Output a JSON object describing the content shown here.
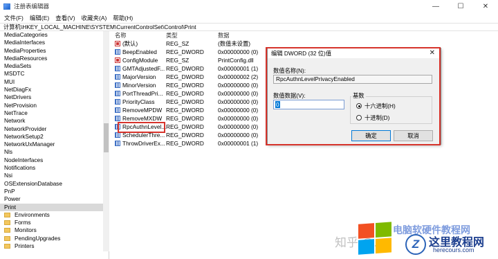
{
  "window": {
    "title": "注册表编辑器",
    "minimize": "—",
    "maximize": "☐",
    "close": "✕"
  },
  "menu": [
    "文件(F)",
    "编辑(E)",
    "查看(V)",
    "收藏夹(A)",
    "帮助(H)"
  ],
  "address": "计算机\\HKEY_LOCAL_MACHINE\\SYSTEM\\CurrentControlSet\\Control\\Print",
  "tree": {
    "items": [
      "MediaCategories",
      "MediaInterfaces",
      "MediaProperties",
      "MediaResources",
      "MediaSets",
      "MSDTC",
      "MUI",
      "NetDiagFx",
      "NetDrivers",
      "NetProvision",
      "NetTrace",
      "Network",
      "NetworkProvider",
      "NetworkSetup2",
      "NetworkUxManager",
      "Nls",
      "NodeInterfaces",
      "Notifications",
      "Nsi",
      "OSExtensionDatabase",
      "PnP",
      "Power",
      "Print"
    ],
    "children": [
      "Environments",
      "Forms",
      "Monitors",
      "PendingUpgrades",
      "Printers"
    ],
    "selected": "Print"
  },
  "list": {
    "headers": {
      "name": "名称",
      "type": "类型",
      "data": "数据"
    },
    "rows": [
      {
        "name": "(默认)",
        "type": "REG_SZ",
        "data": "(数值未设置)",
        "kind": "sz"
      },
      {
        "name": "BeepEnabled",
        "type": "REG_DWORD",
        "data": "0x00000000 (0)",
        "kind": "dw"
      },
      {
        "name": "ConfigModule",
        "type": "REG_SZ",
        "data": "PrintConfig.dll",
        "kind": "sz"
      },
      {
        "name": "GMTAdjustedF...",
        "type": "REG_DWORD",
        "data": "0x00000001 (1)",
        "kind": "dw"
      },
      {
        "name": "MajorVersion",
        "type": "REG_DWORD",
        "data": "0x00000002 (2)",
        "kind": "dw"
      },
      {
        "name": "MinorVersion",
        "type": "REG_DWORD",
        "data": "0x00000000 (0)",
        "kind": "dw"
      },
      {
        "name": "PortThreadPri...",
        "type": "REG_DWORD",
        "data": "0x00000000 (0)",
        "kind": "dw"
      },
      {
        "name": "PriorityClass",
        "type": "REG_DWORD",
        "data": "0x00000000 (0)",
        "kind": "dw"
      },
      {
        "name": "RemoveMPDW",
        "type": "REG_DWORD",
        "data": "0x00000000 (0)",
        "kind": "dw"
      },
      {
        "name": "RemoveMXDW",
        "type": "REG_DWORD",
        "data": "0x00000000 (0)",
        "kind": "dw"
      },
      {
        "name": "RpcAuthnLevel...",
        "type": "REG_DWORD",
        "data": "0x00000000 (0)",
        "kind": "dw"
      },
      {
        "name": "SchedulerThre...",
        "type": "REG_DWORD",
        "data": "0x00000000 (0)",
        "kind": "dw"
      },
      {
        "name": "ThrowDriverEx...",
        "type": "REG_DWORD",
        "data": "0x00000001 (1)",
        "kind": "dw"
      }
    ]
  },
  "dialog": {
    "title": "编辑 DWORD (32 位)值",
    "close": "✕",
    "name_label": "数值名称(N):",
    "name_value": "RpcAuthnLevelPrivacyEnabled",
    "data_label": "数值数据(V):",
    "data_value": "0",
    "base_label": "基数",
    "hex_label": "十六进制(H)",
    "dec_label": "十进制(D)",
    "base_selected": "hex",
    "ok": "确定",
    "cancel": "取消"
  },
  "watermark": {
    "zhihu": "知乎 @...",
    "site_text": "电脑软硬件教程网",
    "logo_text": "这里教程网",
    "logo_sub": "herecours.com"
  }
}
